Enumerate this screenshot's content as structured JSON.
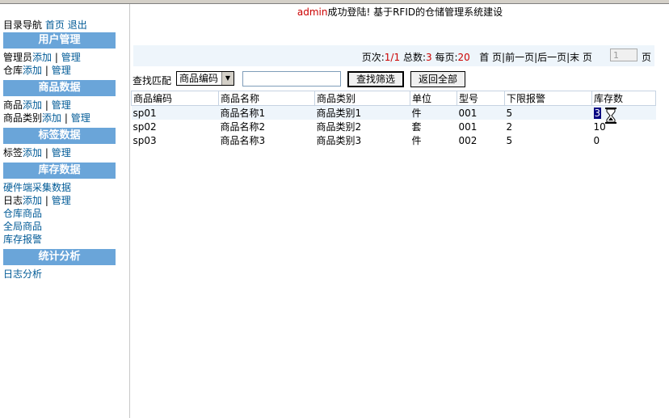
{
  "sidebar": {
    "nav_label": "目录导航",
    "home_link": "首页",
    "logout_link": "退出",
    "sections": [
      {
        "title": "用户管理"
      },
      {
        "title": "商品数据"
      },
      {
        "title": "标签数据"
      },
      {
        "title": "库存数据"
      },
      {
        "title": "统计分析"
      }
    ],
    "admin_label": "管理员",
    "warehouse_label": "仓库",
    "goods_label": "商品",
    "goods_category_label": "商品类别",
    "tag_label": "标签",
    "log_label": "日志",
    "add_link": "添加",
    "manage_link": "管理",
    "separator": "|",
    "hardware_collect": "硬件端采集数据",
    "warehouse_goods": "仓库商品",
    "global_goods": "全局商品",
    "stock_alarm": "库存报警",
    "log_analysis": "日志分析"
  },
  "banner": {
    "user": "admin",
    "message": "成功登陆! 基于RFID的仓储管理系统建设"
  },
  "pager": {
    "page_label": "页次:",
    "page_value": "1/1",
    "total_label": "总数:",
    "total_value": "3",
    "per_page_label": "每页:",
    "per_page_value": "20",
    "nav_text": "首 页|前一页|后一页|末 页",
    "page_input_value": "1",
    "page_unit": "页"
  },
  "filter": {
    "label": "查找匹配",
    "field_selected": "商品编码",
    "search_value": "",
    "search_button": "查找筛选",
    "reset_button": "返回全部"
  },
  "table": {
    "headers": [
      "商品编码",
      "商品名称",
      "商品类别",
      "单位",
      "型号",
      "下限报警",
      "库存数"
    ],
    "rows": [
      [
        "sp01",
        "商品名称1",
        "商品类别1",
        "件",
        "001",
        "5",
        "3"
      ],
      [
        "sp02",
        "商品名称2",
        "商品类别2",
        "套",
        "001",
        "2",
        "10"
      ],
      [
        "sp03",
        "商品名称3",
        "商品类别3",
        "件",
        "002",
        "5",
        "0"
      ]
    ]
  },
  "colors": {
    "section_bg": "#6aa5d9",
    "link": "#005a96",
    "accent_red": "#cc0000",
    "row_highlight": "#eef5fb"
  },
  "icons": {
    "cursor": "hourglass-icon",
    "dropdown": "triangle-down-icon"
  }
}
